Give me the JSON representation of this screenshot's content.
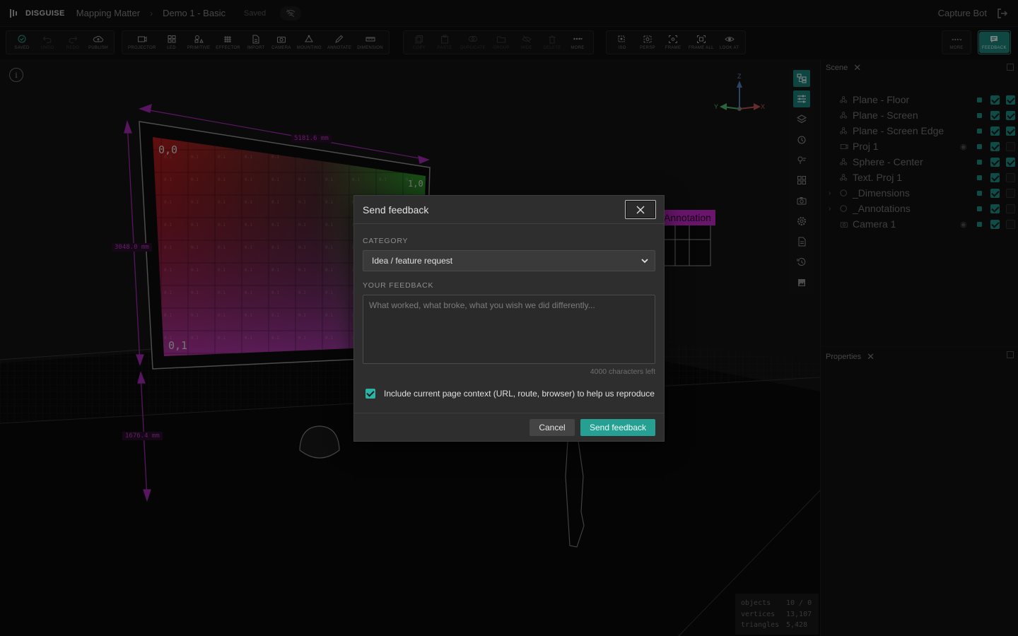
{
  "header": {
    "brand": "DISGUISE",
    "project": "Mapping Matter",
    "scene": "Demo 1 - Basic",
    "saved_status": "Saved",
    "user": "Capture Bot"
  },
  "toolbar": {
    "group1": [
      {
        "label": "SAVED",
        "icon": "check-circle-icon",
        "dim": false,
        "accent": "#2bb3a5"
      },
      {
        "label": "UNDO",
        "icon": "undo-icon",
        "dim": true
      },
      {
        "label": "REDO",
        "icon": "redo-icon",
        "dim": true
      },
      {
        "label": "PUBLISH",
        "icon": "cloud-upload-icon",
        "dim": false
      }
    ],
    "group2": [
      {
        "label": "PROJECTOR",
        "icon": "projector-icon",
        "dim": false
      },
      {
        "label": "LED",
        "icon": "led-grid-icon",
        "dim": false
      },
      {
        "label": "PRIMITIVE",
        "icon": "primitive-icon",
        "dim": false
      },
      {
        "label": "EFFECTOR",
        "icon": "effector-grid-icon",
        "dim": false
      },
      {
        "label": "IMPORT",
        "icon": "import-file-icon",
        "dim": false
      },
      {
        "label": "CAMERA",
        "icon": "camera-icon",
        "dim": false
      },
      {
        "label": "MOUNTING",
        "icon": "mounting-icon",
        "dim": false
      },
      {
        "label": "ANNOTATE",
        "icon": "pen-icon",
        "dim": false
      },
      {
        "label": "DIMENSION",
        "icon": "ruler-icon",
        "dim": false
      }
    ],
    "group3": [
      {
        "label": "COPY",
        "icon": "copy-icon",
        "dim": true
      },
      {
        "label": "PASTE",
        "icon": "paste-icon",
        "dim": true
      },
      {
        "label": "DUPLICATE",
        "icon": "duplicate-icon",
        "dim": true
      },
      {
        "label": "GROUP",
        "icon": "folder-icon",
        "dim": true
      },
      {
        "label": "HIDE",
        "icon": "eye-off-icon",
        "dim": true
      },
      {
        "label": "DELETE",
        "icon": "trash-icon",
        "dim": true
      },
      {
        "label": "MORE",
        "icon": "more-dots-icon",
        "dim": false
      }
    ],
    "group4": [
      {
        "label": "ISO",
        "icon": "iso-view-icon",
        "dim": false
      },
      {
        "label": "PERSP",
        "icon": "persp-view-icon",
        "dim": false
      },
      {
        "label": "FRAME",
        "icon": "frame-icon",
        "dim": false
      },
      {
        "label": "FRAME ALL",
        "icon": "frame-all-icon",
        "dim": false
      },
      {
        "label": "LOOK AT",
        "icon": "look-at-icon",
        "dim": false
      }
    ],
    "more_label": "MORE",
    "feedback_label": "FEEDBACK"
  },
  "viewport": {
    "dim_top": "5181.6 mm",
    "dim_left": "3048.0 mm",
    "dim_bottom": "1676.4 mm",
    "grid_tl": "0,0",
    "grid_tr": "1,0",
    "grid_bl": "0,1",
    "annotation_label": "Annotation",
    "axis_z": "Z",
    "axis_x": "X",
    "axis_y": "Y"
  },
  "stats": [
    {
      "key": "objects",
      "value": "10 / 0"
    },
    {
      "key": "vertices",
      "value": "13,107"
    },
    {
      "key": "triangles",
      "value": "5,428"
    }
  ],
  "scene_panel": {
    "title": "Scene",
    "items": [
      {
        "name": "Plane - Floor",
        "icon": "mesh-icon",
        "expandable": false,
        "eye": false,
        "c1": true,
        "c2": true
      },
      {
        "name": "Plane - Screen",
        "icon": "mesh-icon",
        "expandable": false,
        "eye": false,
        "c1": true,
        "c2": true
      },
      {
        "name": "Plane - Screen Edge",
        "icon": "mesh-icon",
        "expandable": false,
        "eye": false,
        "c1": true,
        "c2": true
      },
      {
        "name": "Proj 1",
        "icon": "projector-icon",
        "expandable": false,
        "eye": true,
        "c1": true,
        "c2": false
      },
      {
        "name": "Sphere - Center",
        "icon": "mesh-icon",
        "expandable": false,
        "eye": false,
        "c1": true,
        "c2": true
      },
      {
        "name": "Text. Proj 1",
        "icon": "mesh-icon",
        "expandable": false,
        "eye": false,
        "c1": true,
        "c2": false
      },
      {
        "name": "_Dimensions",
        "icon": "group-circle-icon",
        "expandable": true,
        "eye": false,
        "c1": true,
        "c2": false
      },
      {
        "name": "_Annotations",
        "icon": "group-circle-icon",
        "expandable": true,
        "eye": false,
        "c1": true,
        "c2": false
      },
      {
        "name": "Camera 1",
        "icon": "camera-icon",
        "expandable": false,
        "eye": true,
        "c1": true,
        "c2": false
      }
    ]
  },
  "props_panel": {
    "title": "Properties"
  },
  "modal": {
    "title": "Send feedback",
    "category_label": "CATEGORY",
    "category_value": "Idea / feature request",
    "feedback_label": "YOUR FEEDBACK",
    "feedback_placeholder": "What worked, what broke, what you wish we did differently...",
    "char_count": "4000 characters left",
    "context_label": "Include current page context (URL, route, browser) to help us reproduce",
    "cancel_label": "Cancel",
    "send_label": "Send feedback"
  },
  "colors": {
    "accent": "#25a093",
    "annotation": "#d22ad6",
    "dimension": "#b02cc0"
  }
}
